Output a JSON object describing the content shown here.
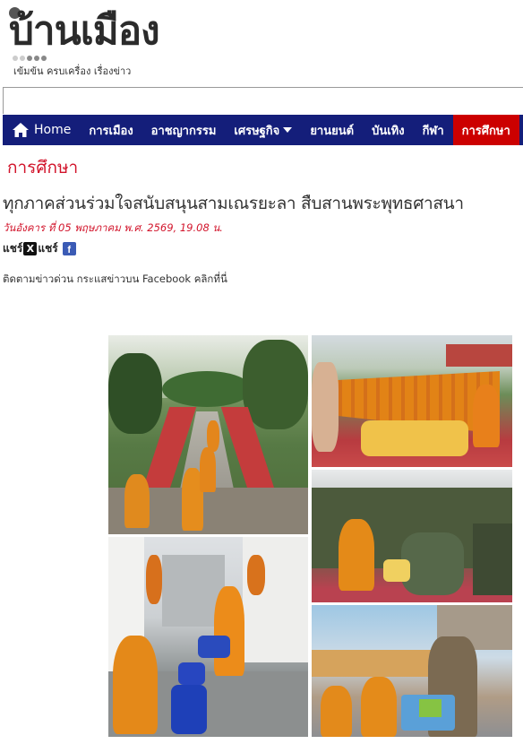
{
  "site": {
    "logo_text": "บ้านเมือง",
    "tagline": "เข้มข้น ครบเครื่อง เรื่องข่าว"
  },
  "nav": {
    "home_label": "Home",
    "items": [
      "การเมือง",
      "อาชญากรรม",
      "เศรษฐกิจ",
      "ยานยนต์",
      "บันเทิง",
      "กีฬา"
    ],
    "active_label": "การศึกษา"
  },
  "article": {
    "category": "การศึกษา",
    "headline": "ทุกภาคส่วนร่วมใจสนับสนุนสามเณรยะลา สืบสานพระพุทธศาสนา",
    "date": "วันอังคาร ที่ 05 พฤษภาคม พ.ศ. 2569, 19.08 น.",
    "share_label_1": "แชร์",
    "share_label_2": "แชร์",
    "follow_text": "ติดตามข่าวด่วน กระแสข่าวบน Facebook คลิกที่นี่"
  },
  "icons": {
    "home": "home-icon",
    "x": "x-icon",
    "facebook": "facebook-icon",
    "dropdown": "chevron-down-icon"
  },
  "colors": {
    "nav_bg": "#141e7a",
    "active_bg": "#cc0000",
    "category": "#d2142b",
    "date": "#d2142b"
  }
}
